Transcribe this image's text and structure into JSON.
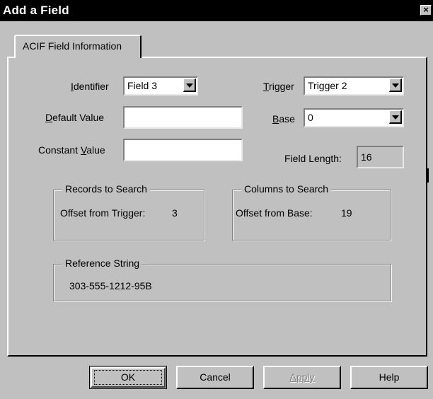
{
  "window": {
    "title": "Add a Field",
    "close_glyph": "×"
  },
  "tabs": [
    {
      "label": "ACIF Field Information"
    }
  ],
  "form": {
    "identifier": {
      "label_prefix": "",
      "label_mnemonic": "I",
      "label_suffix": "dentifier",
      "value": "Field 3"
    },
    "trigger": {
      "label_prefix": "",
      "label_mnemonic": "T",
      "label_suffix": "rigger",
      "value": "Trigger 2"
    },
    "default_value": {
      "label_prefix": "",
      "label_mnemonic": "D",
      "label_suffix": "efault Value",
      "value": ""
    },
    "base": {
      "label_prefix": "",
      "label_mnemonic": "B",
      "label_suffix": "ase",
      "value": "0"
    },
    "constant_value": {
      "label_prefix": "Constant ",
      "label_mnemonic": "V",
      "label_suffix": "alue",
      "value": ""
    },
    "field_length": {
      "label": "Field Length:",
      "value": "16"
    }
  },
  "records_to_search": {
    "title": "Records to Search",
    "label": "Offset from Trigger:",
    "value": "3"
  },
  "columns_to_search": {
    "title": "Columns to Search",
    "label": "Offset from Base:",
    "value": "19"
  },
  "reference_string": {
    "title": "Reference String",
    "value": "303-555-1212-95B"
  },
  "buttons": {
    "ok": "OK",
    "cancel": "Cancel",
    "apply": "Apply",
    "help": "Help"
  },
  "colors": {
    "face": "#c0c0c0",
    "titlebar": "#000000",
    "shadow": "#808080",
    "highlight": "#ffffff"
  },
  "icons": {
    "close": "close-icon",
    "dropdown": "chevron-down-icon"
  }
}
